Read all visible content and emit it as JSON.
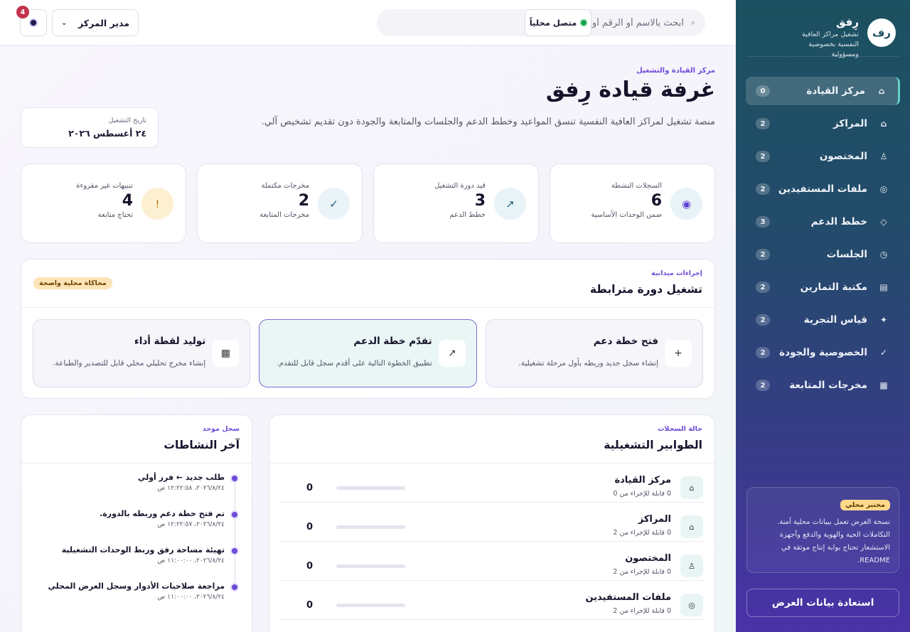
{
  "brand": {
    "logo": "رف",
    "name": "رِفق",
    "subtitle": "تشغيل مراكز العافية النفسية بخصوصية ومسؤولية"
  },
  "nav": [
    {
      "label": "مركز القيادة",
      "count": "0",
      "icon": "⌂",
      "active": true
    },
    {
      "label": "المراكز",
      "count": "2",
      "icon": "⌂"
    },
    {
      "label": "المختصون",
      "count": "2",
      "icon": "♙"
    },
    {
      "label": "ملفات المستفيدين",
      "count": "2",
      "icon": "◎"
    },
    {
      "label": "خطط الدعم",
      "count": "3",
      "icon": "◇"
    },
    {
      "label": "الجلسات",
      "count": "2",
      "icon": "◷"
    },
    {
      "label": "مكتبة التمارين",
      "count": "2",
      "icon": "▤"
    },
    {
      "label": "قياس التجربة",
      "count": "2",
      "icon": "✦"
    },
    {
      "label": "الخصوصية والجودة",
      "count": "2",
      "icon": "✓"
    },
    {
      "label": "مخرجات المتابعة",
      "count": "2",
      "icon": "▦"
    }
  ],
  "lab": {
    "badge": "مختبر محلي",
    "text": "نسخة العرض تعمل ببيانات محلية آمنة. التكاملات الحية والهوية والدفع وأجهزة الاستشعار تحتاج بوابة إنتاج موثقة في README."
  },
  "restore_label": "استعادة بيانات العرض",
  "topbar": {
    "search_placeholder": "ابحث بالاسم أو الرقم أو الحالة...",
    "status": "متصل محلياً",
    "role": "مدير المركز",
    "notifications": "4"
  },
  "header": {
    "eyebrow": "مركز القيادة والتشغيل",
    "title": "غرفة قيادة رِفق",
    "description": "منصة تشغيل لمراكز العافية النفسية تنسق المواعيد وخطط الدعم والجلسات والمتابعة والجودة دون تقديم تشخيص آلي.",
    "date_label": "تاريخ التشغيل",
    "date_value": "٢٤ أغسطس ٢٠٢٦"
  },
  "stats": [
    {
      "label": "السجلات النشطة",
      "value": "6",
      "sub": "ضمن الوحدات الأساسية",
      "icon": "◉",
      "bg": "#e8f3f7",
      "fg": "#5b3fd6"
    },
    {
      "label": "قيد دورة التشغيل",
      "value": "3",
      "sub": "خطط الدعم",
      "icon": "↗",
      "bg": "#e8f3f7",
      "fg": "#1f5f7a"
    },
    {
      "label": "مخرجات مكتملة",
      "value": "2",
      "sub": "مخرجات المتابعة",
      "icon": "✓",
      "bg": "#eaf4f8",
      "fg": "#1f5f7a"
    },
    {
      "label": "تنبيهات غير مقروءة",
      "value": "4",
      "sub": "تحتاج متابعة",
      "icon": "!",
      "bg": "#fdf0d2",
      "fg": "#b7791f"
    }
  ],
  "ops": {
    "eyebrow": "إجراءات ميدانية",
    "title": "تشغيل دورة مترابطة",
    "badge": "محاكاة محلية واضحة",
    "actions": [
      {
        "title": "فتح خطة دعم",
        "desc": "إنشاء سجل جديد وربطه بأول مرحلة تشغيلية.",
        "icon": "+"
      },
      {
        "title": "تقدّم خطة الدعم",
        "desc": "تطبيق الخطوة التالية على أقدم سجل قابل للتقدم.",
        "icon": "↗"
      },
      {
        "title": "توليد لقطة أداء",
        "desc": "إنشاء مخرج تحليلي محلي قابل للتصدير والطباعة.",
        "icon": "▦"
      }
    ]
  },
  "queues": {
    "eyebrow": "حالة السجلات",
    "title": "الطوابير التشغيلية",
    "rows": [
      {
        "name": "مركز القيادة",
        "sub": "0 قابلة للإجراء من 0",
        "count": "0",
        "icon": "⌂"
      },
      {
        "name": "المراكز",
        "sub": "0 قابلة للإجراء من 2",
        "count": "0",
        "icon": "⌂"
      },
      {
        "name": "المختصون",
        "sub": "0 قابلة للإجراء من 2",
        "count": "0",
        "icon": "♙"
      },
      {
        "name": "ملفات المستفيدين",
        "sub": "0 قابلة للإجراء من 2",
        "count": "0",
        "icon": "◎"
      }
    ]
  },
  "activity": {
    "eyebrow": "سجل موحد",
    "title": "آخر النشاطات",
    "items": [
      {
        "title": "طلب جديد ← فرز أولي",
        "time": "٢٠٢٦/٨/٢٤، ١٢:٢٢:٥٨ ص"
      },
      {
        "title": "تم فتح خطة دعم وربطه بالدورة.",
        "time": "٢٠٢٦/٨/٢٤، ١٢:٢٢:٥٧ ص"
      },
      {
        "title": "تهيئة مساحة رفق وربط الوحدات التشغيلية",
        "time": "٢٠٢٦/٨/٢٤، ١١:٠٠:٠٠ ص"
      },
      {
        "title": "مراجعة صلاحيات الأدوار وسجل العرض المحلي",
        "time": "٢٠٢٦/٨/٢٤، ١١:٠٠:٠٠ ص"
      }
    ]
  }
}
